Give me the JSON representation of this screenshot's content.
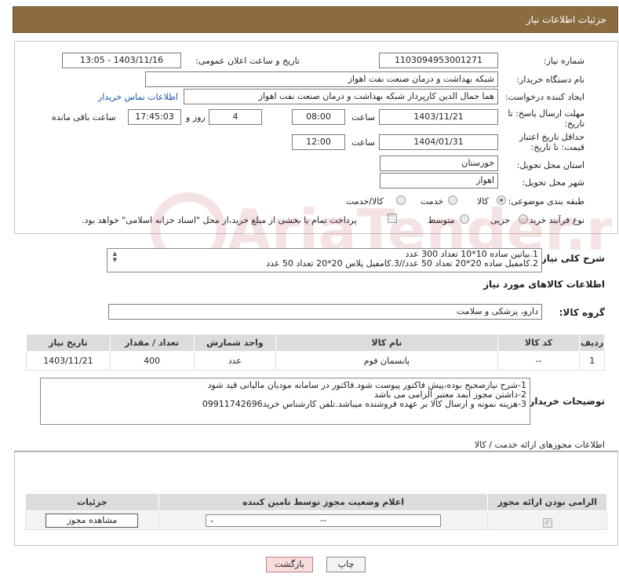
{
  "header": {
    "title": "جزئیات اطلاعات نیاز"
  },
  "form": {
    "need_number_label": "شماره نیاز:",
    "need_number": "1103094953001271",
    "announce_label": "تاریخ و ساعت اعلان عمومی:",
    "announce_value": "1403/11/16 - 13:05",
    "buyer_org_label": "نام دستگاه خریدار:",
    "buyer_org": "شبکه بهداشت و درمان صنعت نفت اهواز",
    "requester_label": "ایجاد کننده درخواست:",
    "requester": "هما جمال الدین کارپرداز شبکه بهداشت و درمان صنعت نفت اهواز",
    "contact_link": "اطلاعات تماس خریدار",
    "deadline_label": "مهلت ارسال پاسخ: تا تاریخ:",
    "deadline_date": "1403/11/21",
    "time_label": "ساعت",
    "deadline_time": "08:00",
    "days_value": "4",
    "days_label": "روز و",
    "remaining_time": "17:45:03",
    "remaining_label": "ساعت باقی مانده",
    "validity_label": "حداقل تاریخ اعتبار قیمت: تا تاریخ:",
    "validity_date": "1404/01/31",
    "validity_time": "12:00",
    "province_label": "استان محل تحویل:",
    "province": "خوزستان",
    "city_label": "شهر محل تحویل:",
    "city": "اهواز",
    "category_label": "طبقه بندی موضوعی:",
    "category_options": [
      "کالا",
      "خدمت",
      "کالا/خدمت"
    ],
    "category_selected": "کالا",
    "process_label": "نوع فرآیند خرید :",
    "process_options": [
      "جزیی",
      "متوسط"
    ],
    "payment_note": "پرداخت تمام یا بخشی از مبلغ خرید،از محل \"اسناد خزانه اسلامی\" خواهد بود."
  },
  "description": {
    "label": "شرح کلی نیاز:",
    "lines": [
      "1.بیاتین ساده 10*10 تعداد 300 عدد",
      "2.کامفیل ساده  20*20 تعداد 50 عدد//3.کامفیل پلاس 20*20 تعداد 50 عدد"
    ]
  },
  "goods": {
    "title": "اطلاعات کالاهای مورد نیاز",
    "group_label": "گروه کالا:",
    "group_value": "دارو، پزشکی و سلامت",
    "columns": [
      "ردیف",
      "کد کالا",
      "نام کالا",
      "واحد شمارش",
      "تعداد / مقدار",
      "تاریخ نیاز"
    ],
    "rows": [
      {
        "row": "1",
        "code": "--",
        "name": "پانسمان فوم",
        "unit": "عدد",
        "qty": "400",
        "date": "1403/11/21"
      }
    ]
  },
  "buyer_notes": {
    "label": "توضیحات خریدار:",
    "lines": [
      "1-شرح نیازصحیح بوده،پیش فاکتور  پیوست شود.فاکتور در سامانه مودیان مالیاتی قید شود",
      "2-داشتن مجوز ایمد معتبر الزامی می باشد",
      "3-هزینه نمونه و ارسال کالا بر عهده فروشنده میباشد.تلفن کارشناس خرید09911742696"
    ]
  },
  "permits": {
    "title": "اطلاعات مجوزهای ارائه خدمت / کالا",
    "columns": [
      "الزامی بودن ارائه مجوز",
      "اعلام وضعیت مجوز توسط تامین کننده",
      "جزئیات"
    ],
    "select_value": "--",
    "view_button": "مشاهده مجوز"
  },
  "actions": {
    "print": "چاپ",
    "back": "بازگشت"
  },
  "watermark": {
    "text": "AriaTender.neT"
  }
}
